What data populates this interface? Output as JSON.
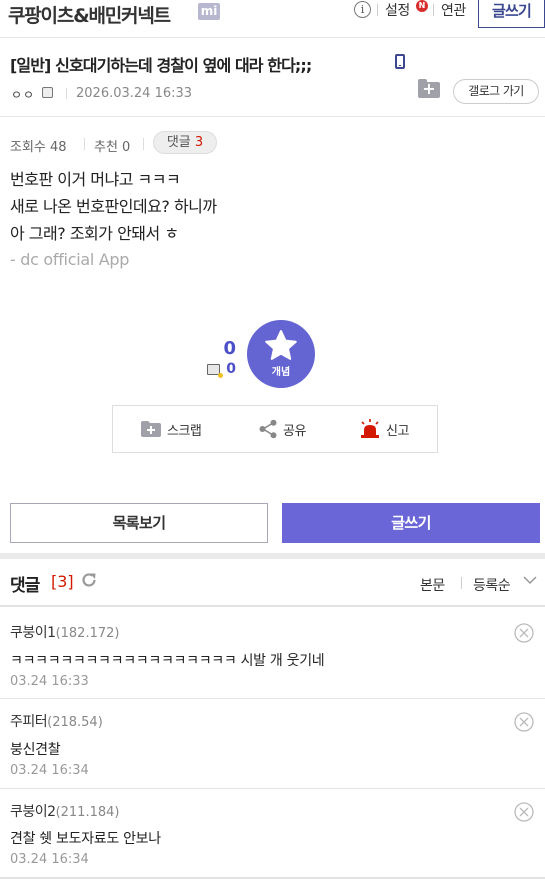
{
  "header": {
    "gallery_title": "쿠팡이츠&배민커넥트",
    "badge": "mi",
    "info_glyph": "i",
    "settings": "설정",
    "notification_badge": "N",
    "related": "연관",
    "write": "글쓰기"
  },
  "post": {
    "title": "[일반] 신호대기하는데 경찰이 옆에 대라 한다;;;",
    "author": "ㅇㅇ",
    "date": "2026.03.24 16:33",
    "gallery_go": "갤로그 가기",
    "views": "조회수 48",
    "recommends": "추천 0",
    "comment_pill_label": "댓글",
    "comment_pill_count": "3",
    "body": [
      "번호판 이거 머냐고 ㅋㅋㅋ",
      "새로 나온 번호판인데요? 하니까",
      "아 그래? 조회가 안돼서 ㅎ"
    ],
    "signature": "- dc official App"
  },
  "recommend": {
    "count": "0",
    "fix_count": "0",
    "button_label": "개념"
  },
  "actions": {
    "scrap": "스크랩",
    "share": "공유",
    "report": "신고"
  },
  "buttons": {
    "list": "목록보기",
    "write": "글쓰기"
  },
  "comments": {
    "heading": "댓글",
    "count": "[3]",
    "sort_body": "본문",
    "sort_order": "등록순",
    "items": [
      {
        "nick": "쿠붕이1",
        "ip": "(182.172)",
        "text": "ㅋㅋㅋㅋㅋㅋㅋㅋㅋㅋㅋㅋㅋㅋㅋㅋㅋㅋ 시발 개 웃기네",
        "date": "03.24 16:33"
      },
      {
        "nick": "주피터",
        "ip": "(218.54)",
        "text": "붕신견찰",
        "date": "03.24 16:34"
      },
      {
        "nick": "쿠붕이2",
        "ip": "(211.184)",
        "text": "견찰 쉣 보도자료도 안보나",
        "date": "03.24 16:34"
      }
    ]
  },
  "colors": {
    "accent": "#6b66d8",
    "brand_navy": "#3b4890",
    "red": "#d31900"
  }
}
